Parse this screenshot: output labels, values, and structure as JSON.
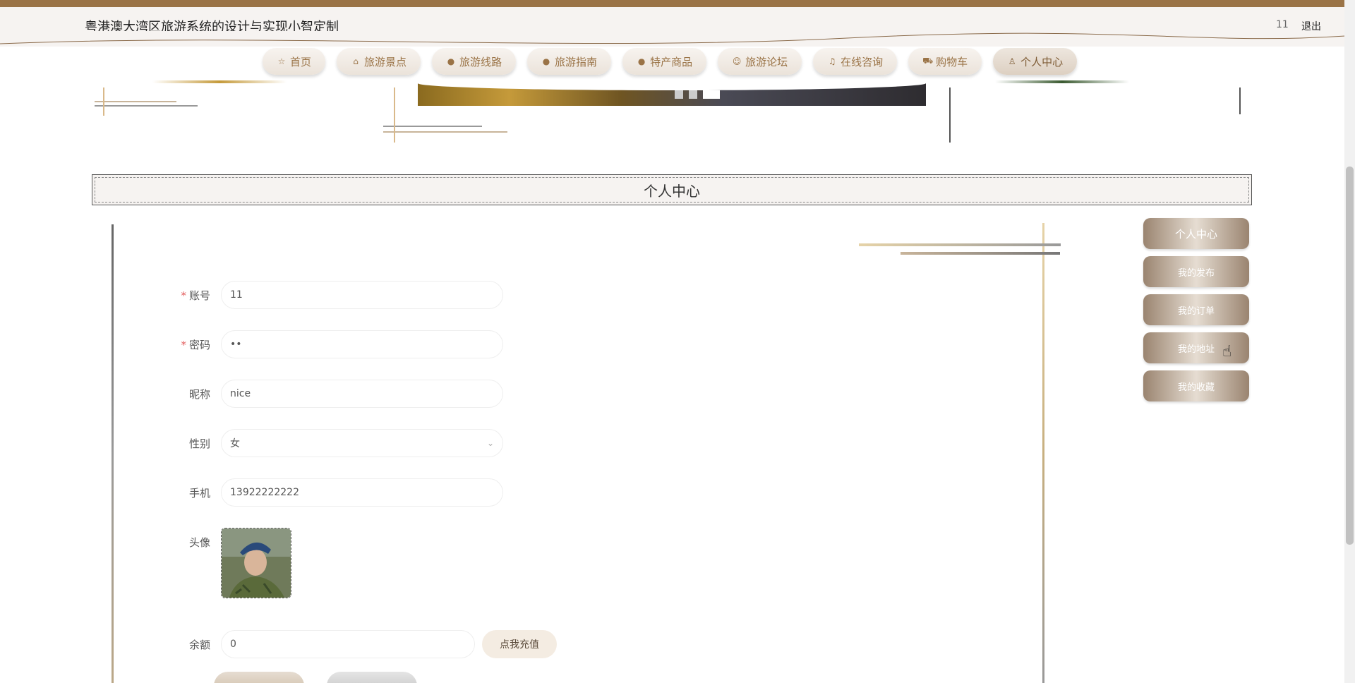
{
  "header": {
    "site_title": "粤港澳大湾区旅游系统的设计与实现小智定制",
    "username": "11",
    "logout_label": "退出"
  },
  "nav": {
    "items": [
      {
        "label": "首页",
        "icon": "star-icon"
      },
      {
        "label": "旅游景点",
        "icon": "bag-icon"
      },
      {
        "label": "旅游线路",
        "icon": "info-circle-icon"
      },
      {
        "label": "旅游指南",
        "icon": "question-circle-icon"
      },
      {
        "label": "特产商品",
        "icon": "info-circle-icon"
      },
      {
        "label": "旅游论坛",
        "icon": "smile-icon"
      },
      {
        "label": "在线咨询",
        "icon": "headset-icon"
      },
      {
        "label": "购物车",
        "icon": "cart-icon"
      },
      {
        "label": "个人中心",
        "icon": "user-icon"
      }
    ],
    "active_index": 8
  },
  "section": {
    "title": "个人中心"
  },
  "form": {
    "account_label": "账号",
    "account_value": "11",
    "password_label": "密码",
    "password_value": "••",
    "nickname_label": "昵称",
    "nickname_value": "nice",
    "gender_label": "性别",
    "gender_value": "女",
    "phone_label": "手机",
    "phone_value": "13922222222",
    "avatar_label": "头像",
    "balance_label": "余额",
    "balance_value": "0",
    "recharge_label": "点我充值",
    "required_mark": "*"
  },
  "side_menu": {
    "items": [
      "个人中心",
      "我的发布",
      "我的订单",
      "我的地址",
      "我的收藏"
    ]
  },
  "colors": {
    "accent": "#9a7346",
    "header_bg": "#f6f3f1",
    "required": "#e25d5d"
  }
}
